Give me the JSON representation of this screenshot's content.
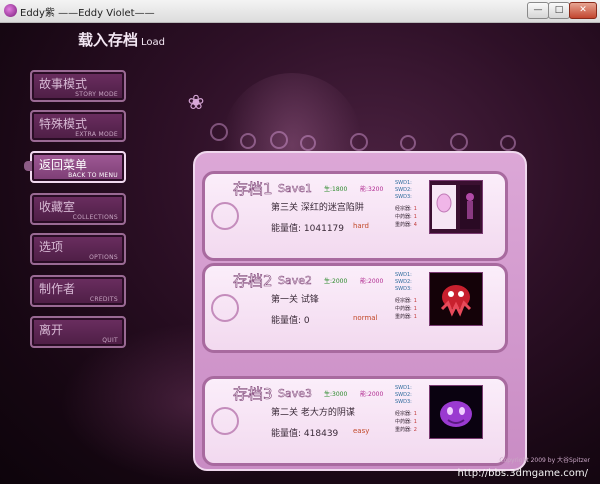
{
  "window": {
    "title": "Eddy紫 ——Eddy Violet——",
    "min": "—",
    "max": "□",
    "close": "✕"
  },
  "screen": {
    "title": "载入存档",
    "title_sub": "Load"
  },
  "menu": [
    {
      "cn": "故事模式",
      "en": "STORY MODE"
    },
    {
      "cn": "特殊模式",
      "en": "EXTRA MODE"
    },
    {
      "cn": "返回菜单",
      "en": "BACK TO MENU"
    },
    {
      "cn": "收藏室",
      "en": "COLLECTIONS"
    },
    {
      "cn": "选项",
      "en": "OPTIONS"
    },
    {
      "cn": "制作者",
      "en": "CREDITS"
    },
    {
      "cn": "离开",
      "en": "QUIT"
    }
  ],
  "slots": [
    {
      "label_cn": "存档1",
      "label_en": "Save1",
      "life_label": "生:",
      "life": "1800",
      "energy_label": "能:",
      "energy": "3200",
      "stage": "第三关 深红的迷宫陷阱",
      "power_label": "能量值:",
      "power": "1041179",
      "difficulty": "hard",
      "swd": [
        "SWD1:",
        "SWD2:",
        "SWD3:"
      ],
      "counts": [
        {
          "label": "经宗器:",
          "value": "1"
        },
        {
          "label": "中药器:",
          "value": "1"
        },
        {
          "label": "重药器:",
          "value": "4"
        }
      ]
    },
    {
      "label_cn": "存档2",
      "label_en": "Save2",
      "life_label": "生:",
      "life": "2000",
      "energy_label": "能:",
      "energy": "2000",
      "stage": "第一关 试锋",
      "power_label": "能量值:",
      "power": "0",
      "difficulty": "normal",
      "swd": [
        "SWD1:",
        "SWD2:",
        "SWD3:"
      ],
      "counts": [
        {
          "label": "经宗器:",
          "value": "1"
        },
        {
          "label": "中药器:",
          "value": "1"
        },
        {
          "label": "重药器:",
          "value": "1"
        }
      ]
    },
    {
      "label_cn": "存档3",
      "label_en": "Save3",
      "life_label": "生:",
      "life": "3000",
      "energy_label": "能:",
      "energy": "2000",
      "stage": "第二关 老大方的阴谋",
      "power_label": "能量值:",
      "power": "418439",
      "difficulty": "easy",
      "swd": [
        "SWD1:",
        "SWD2:",
        "SWD3:"
      ],
      "counts": [
        {
          "label": "经宗器:",
          "value": "1"
        },
        {
          "label": "中药器:",
          "value": "1"
        },
        {
          "label": "重药器:",
          "value": "2"
        }
      ]
    }
  ],
  "footer": "Copyright 2009 by 大谷Spitzer",
  "watermark": "http://bbs.3dmgame.com/"
}
